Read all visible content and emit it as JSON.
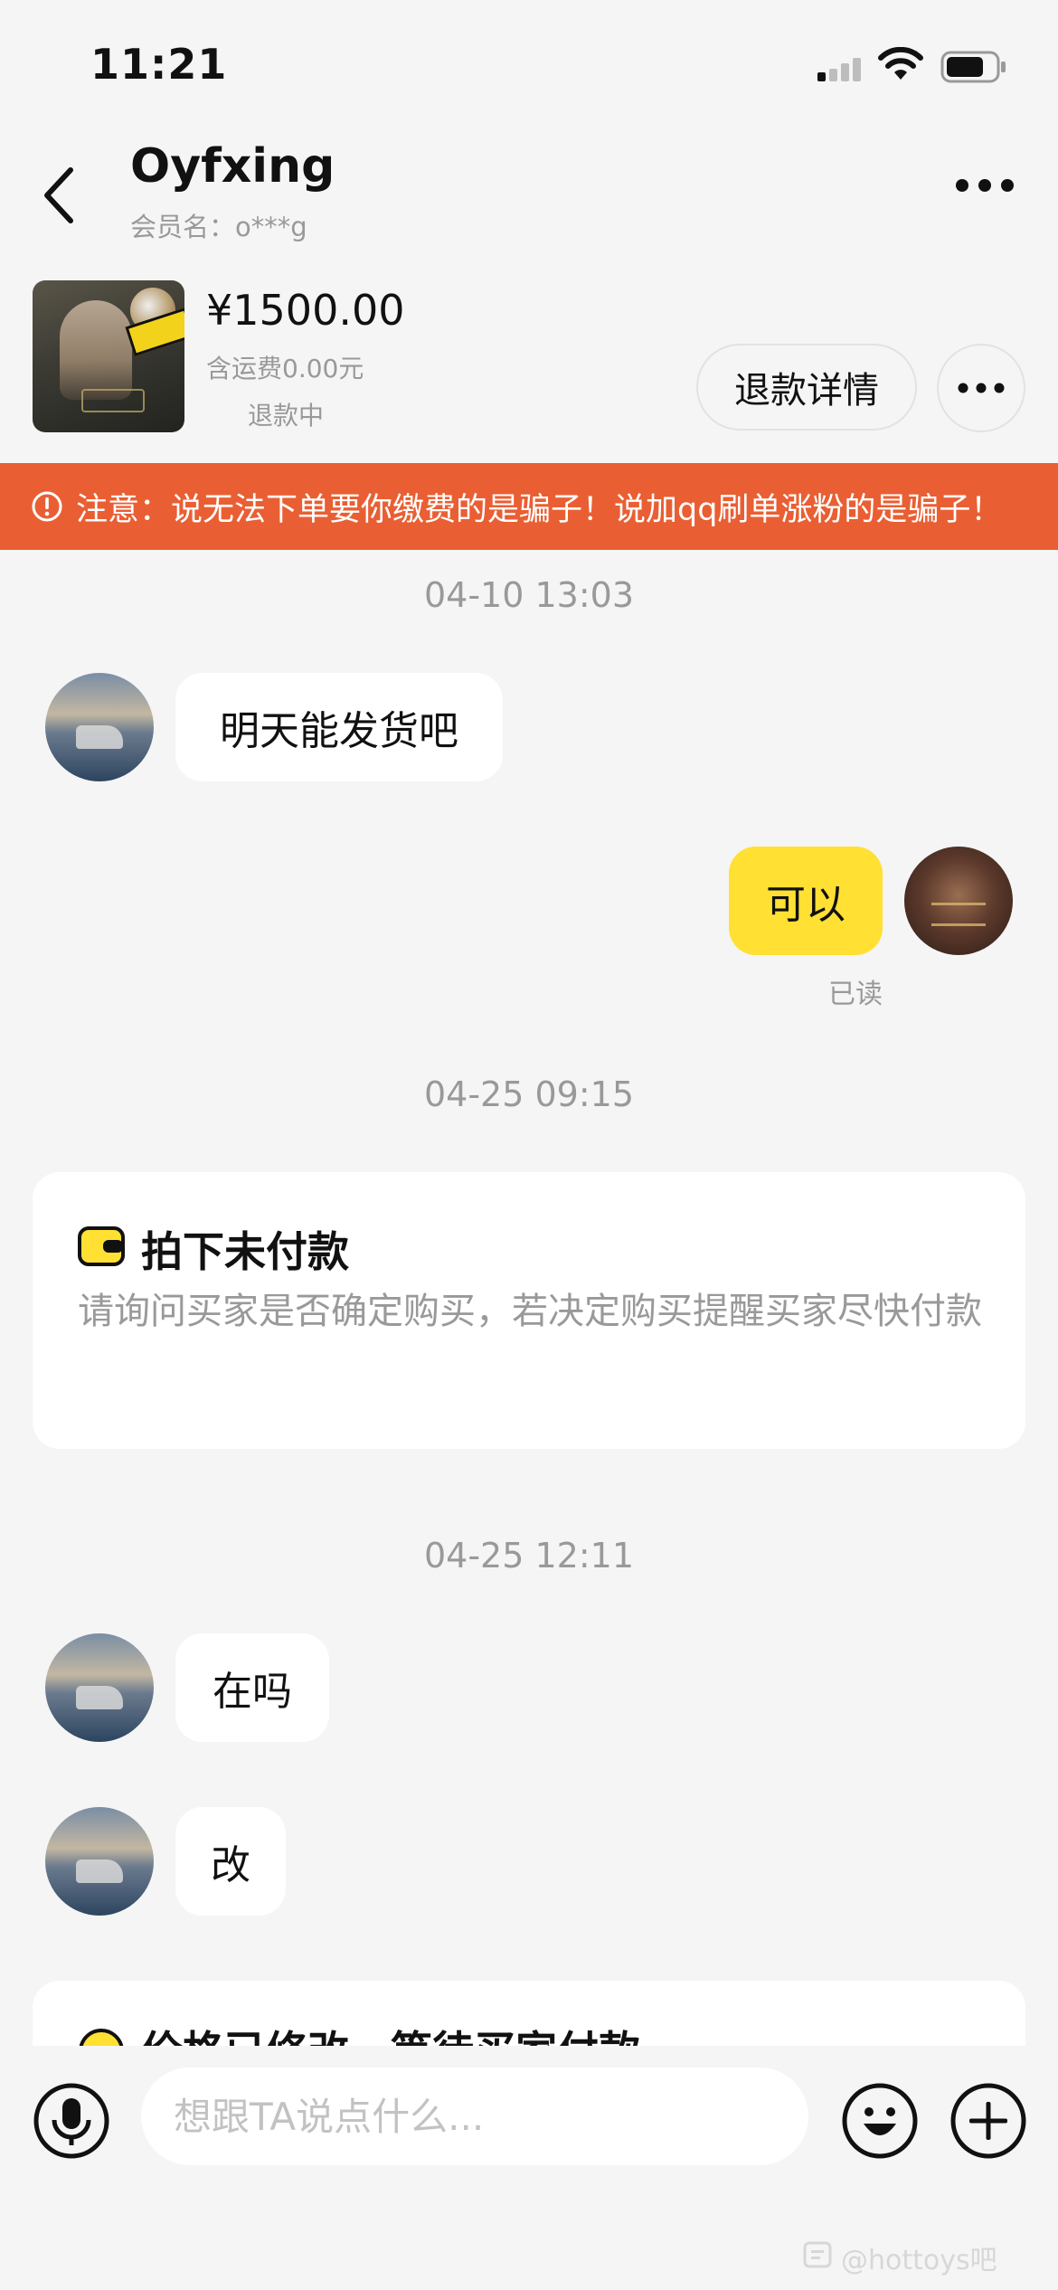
{
  "status_bar": {
    "time": "11:21"
  },
  "header": {
    "title": "Oyfxing",
    "subtitle": "会员名：o***g"
  },
  "product": {
    "price": "¥1500.00",
    "shipping": "含运费0.00元",
    "status": "退款中",
    "refund_button": "退款详情"
  },
  "warning": {
    "text": "注意：说无法下单要你缴费的是骗子！说加qq刷单涨粉的是骗子！"
  },
  "chat": {
    "groups": [
      {
        "timestamp": "04-10 13:03"
      },
      {
        "timestamp": "04-25 09:15"
      },
      {
        "timestamp": "04-25 12:11"
      }
    ],
    "messages": [
      {
        "from": "buyer",
        "text": "明天能发货吧"
      },
      {
        "from": "self",
        "text": "可以",
        "read": "已读"
      },
      {
        "from": "buyer",
        "text": "在吗"
      },
      {
        "from": "buyer",
        "text": "改"
      }
    ],
    "card": {
      "title": "拍下未付款",
      "text": "请询问买家是否确定购买，若决定购买提醒买家尽快付款",
      "icon": "wallet-icon",
      "accent": "#ffe033"
    },
    "card2": {
      "title": "价格已修改，等待买家付款"
    }
  },
  "input": {
    "placeholder": "想跟TA说点什么..."
  },
  "watermark": "@hottoys吧",
  "colors": {
    "background": "#f5f5f5",
    "warning": "#e95f33",
    "self_bubble": "#ffe033"
  }
}
